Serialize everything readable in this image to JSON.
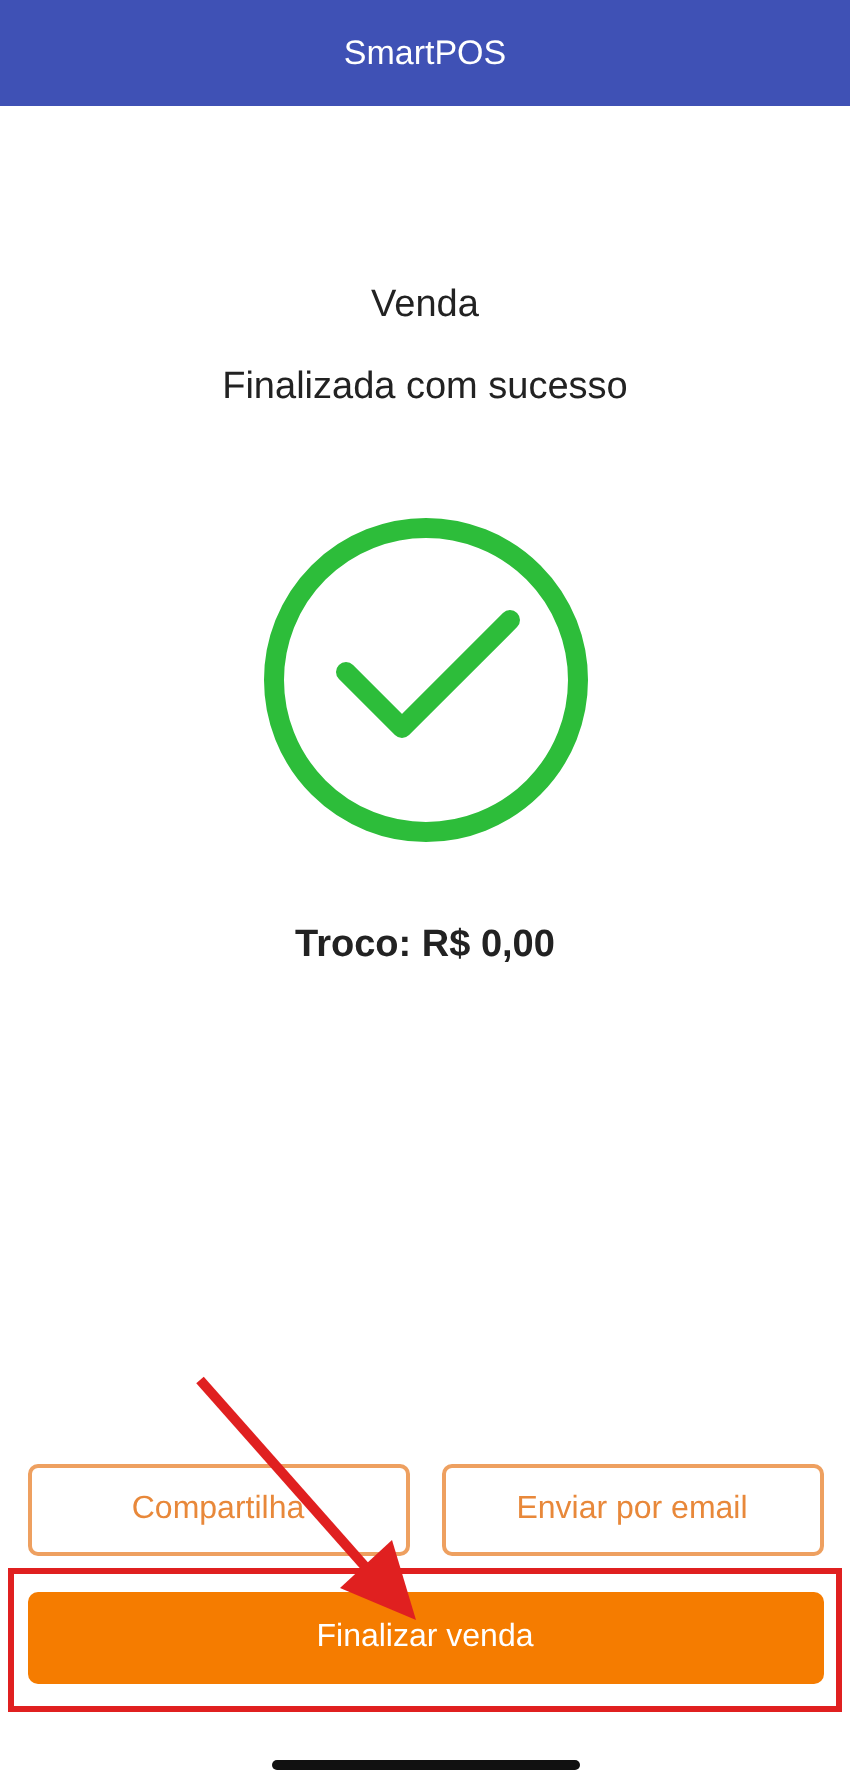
{
  "app_bar": {
    "title": "SmartPOS"
  },
  "status": {
    "title": "Venda",
    "subtitle": "Finalizada com sucesso",
    "change": "Troco: R$ 0,00"
  },
  "actions": [
    {
      "label": "Compartilha",
      "kind": "outline"
    },
    {
      "label": "Enviar por email",
      "kind": "outline"
    },
    {
      "label": "Finalizar venda",
      "kind": "primary"
    }
  ]
}
